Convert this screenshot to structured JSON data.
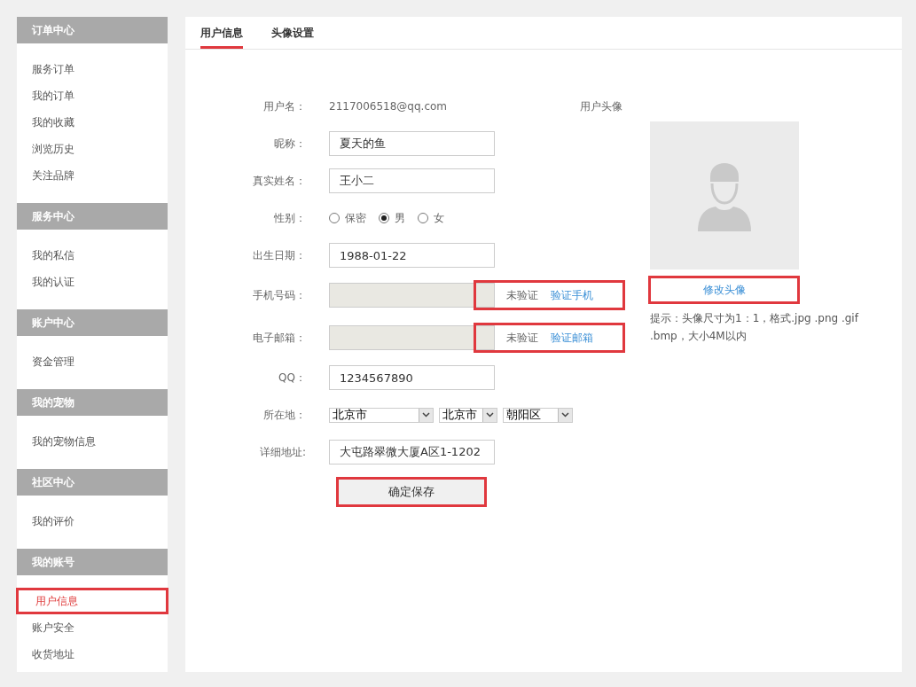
{
  "sidebar": {
    "groups": [
      {
        "title": "订单中心",
        "items": [
          {
            "label": "服务订单",
            "selected": false,
            "highlighted": false
          },
          {
            "label": "我的订单",
            "selected": false,
            "highlighted": false
          },
          {
            "label": "我的收藏",
            "selected": false,
            "highlighted": false
          },
          {
            "label": "浏览历史",
            "selected": false,
            "highlighted": false
          },
          {
            "label": "关注品牌",
            "selected": false,
            "highlighted": false
          }
        ]
      },
      {
        "title": "服务中心",
        "items": [
          {
            "label": "我的私信",
            "selected": false,
            "highlighted": false
          },
          {
            "label": "我的认证",
            "selected": false,
            "highlighted": false
          }
        ]
      },
      {
        "title": "账户中心",
        "items": [
          {
            "label": "资金管理",
            "selected": false,
            "highlighted": false
          }
        ]
      },
      {
        "title": "我的宠物",
        "items": [
          {
            "label": "我的宠物信息",
            "selected": false,
            "highlighted": false
          }
        ]
      },
      {
        "title": "社区中心",
        "items": [
          {
            "label": "我的评价",
            "selected": false,
            "highlighted": false
          }
        ]
      },
      {
        "title": "我的账号",
        "items": [
          {
            "label": "用户信息",
            "selected": true,
            "highlighted": true
          },
          {
            "label": "账户安全",
            "selected": false,
            "highlighted": false
          },
          {
            "label": "收货地址",
            "selected": false,
            "highlighted": false
          }
        ]
      }
    ]
  },
  "tabs": [
    {
      "label": "用户信息",
      "selected": true
    },
    {
      "label": "头像设置",
      "selected": false
    }
  ],
  "form": {
    "rows": [
      {
        "kind": "text",
        "label": "用户名：",
        "value": "2117006518@qq.com"
      },
      {
        "kind": "input",
        "label": "昵称：",
        "value": "夏天的鱼"
      },
      {
        "kind": "input",
        "label": "真实姓名：",
        "value": "王小二"
      },
      {
        "kind": "radio",
        "label": "性别：",
        "options": [
          {
            "label": "保密",
            "selected": false
          },
          {
            "label": "男",
            "selected": true
          },
          {
            "label": "女",
            "selected": false
          }
        ]
      },
      {
        "kind": "input",
        "label": "出生日期：",
        "value": "1988-01-22"
      },
      {
        "kind": "verify",
        "label": "手机号码：",
        "status": "未验证",
        "link": "验证手机",
        "highlighted": true
      },
      {
        "kind": "verify",
        "label": "电子邮箱：",
        "status": "未验证",
        "link": "验证邮箱",
        "highlighted": true
      },
      {
        "kind": "input",
        "label": "QQ：",
        "value": "1234567890"
      },
      {
        "kind": "select",
        "label": "所在地：",
        "selects": [
          {
            "value": "北京市"
          },
          {
            "value": "北京市"
          },
          {
            "value": "朝阳区"
          }
        ]
      },
      {
        "kind": "input",
        "label": "详细地址:",
        "value": "大屯路翠微大厦A区1-1202"
      }
    ],
    "save_button": {
      "label": "确定保存",
      "highlighted": true
    }
  },
  "avatar": {
    "label": "用户头像",
    "button": {
      "label": "修改头像",
      "highlighted": true
    },
    "hint": "提示：头像尺寸为1：1，格式.jpg .png .gif .bmp，大小4M以内"
  }
}
